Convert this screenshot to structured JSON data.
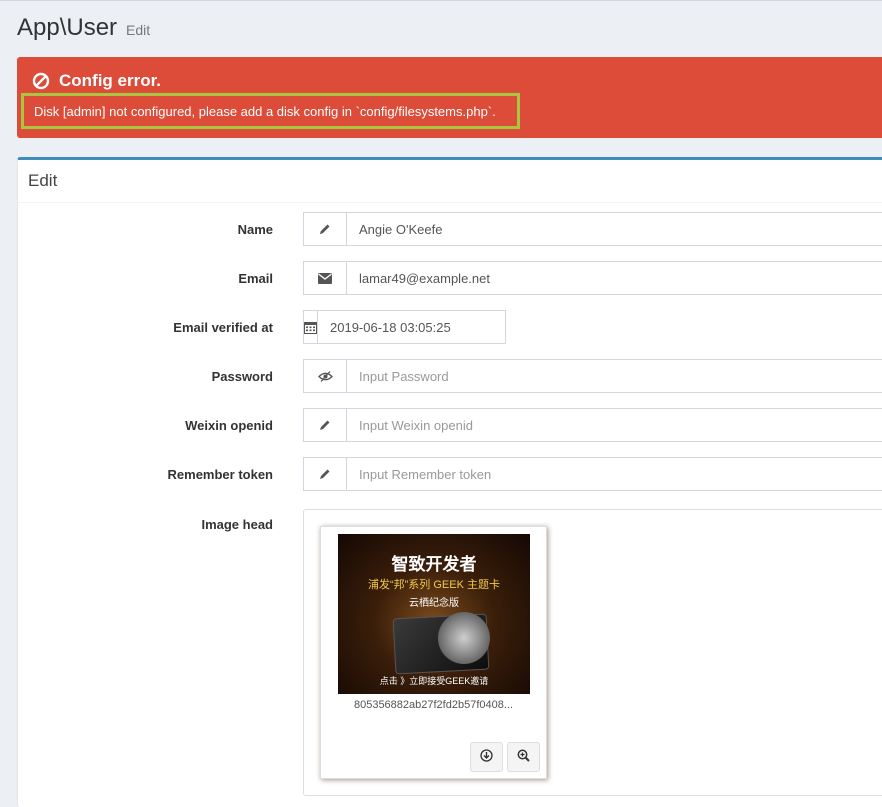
{
  "header": {
    "title": "App\\User",
    "subtitle": "Edit"
  },
  "alert": {
    "title": "Config error.",
    "message": "Disk [admin] not configured, please add a disk config in `config/filesystems.php`.",
    "color": "#dd4b39",
    "icon": "ban-icon"
  },
  "box": {
    "title": "Edit",
    "accent": "#3c8dbc"
  },
  "fields": {
    "name": {
      "label": "Name",
      "value": "Angie O'Keefe",
      "icon": "pencil-icon"
    },
    "email": {
      "label": "Email",
      "value": "lamar49@example.net",
      "icon": "envelope-icon"
    },
    "email_verified_at": {
      "label": "Email verified at",
      "value": "2019-06-18 03:05:25",
      "icon": "calendar-icon"
    },
    "password": {
      "label": "Password",
      "placeholder": "Input Password",
      "icon": "eye-slash-icon"
    },
    "weixin_openid": {
      "label": "Weixin openid",
      "placeholder": "Input Weixin openid",
      "icon": "pencil-icon"
    },
    "remember_token": {
      "label": "Remember token",
      "placeholder": "Input Remember token",
      "icon": "pencil-icon"
    },
    "image_head": {
      "label": "Image head",
      "filename": "805356882ab27f2fd2b57f0408...",
      "thumb_lines": [
        "智致开发者",
        "浦发“邦”系列 GEEK 主题卡",
        "云栖纪念版",
        "点击 》立即接受GEEK邀请"
      ],
      "actions": [
        "download-icon",
        "zoom-in-icon"
      ]
    }
  }
}
